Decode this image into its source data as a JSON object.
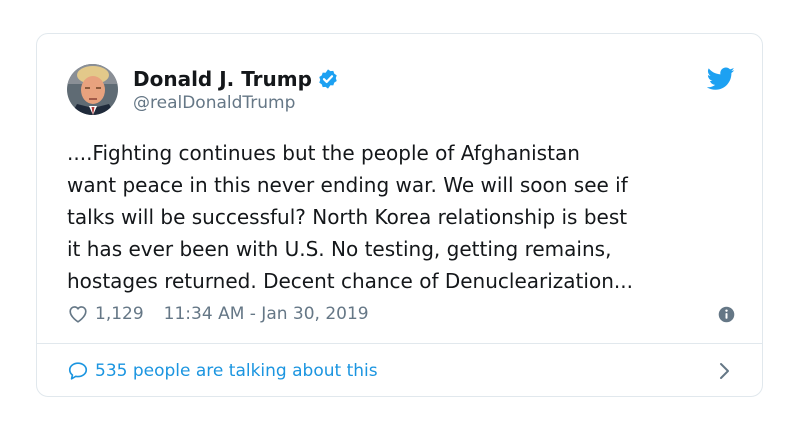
{
  "author": {
    "display_name": "Donald J. Trump",
    "handle": "@realDonaldTrump",
    "verified": true,
    "avatar_icon": "profile-photo"
  },
  "tweet": {
    "text": "....Fighting continues but the people of Afghanistan\nwant peace in this never ending war. We will soon see if\ntalks will be successful? North Korea relationship is best\nit has ever been with U.S. No testing, getting remains,\nhostages returned. Decent chance of Denuclearization..."
  },
  "meta": {
    "likes": "1,129",
    "timestamp": "11:34 AM - Jan 30, 2019",
    "like_icon": "heart-icon",
    "info_icon": "info-icon"
  },
  "footer": {
    "talking_label": "535 people are talking about this",
    "icon": "speech-bubble-icon",
    "chevron_icon": "chevron-right-icon"
  },
  "colors": {
    "text": "#14171a",
    "muted": "#657786",
    "link": "#1b95e0",
    "twitter_blue": "#1da1f2",
    "border": "#e1e8ed"
  },
  "brand_icon": "twitter-bird-icon"
}
